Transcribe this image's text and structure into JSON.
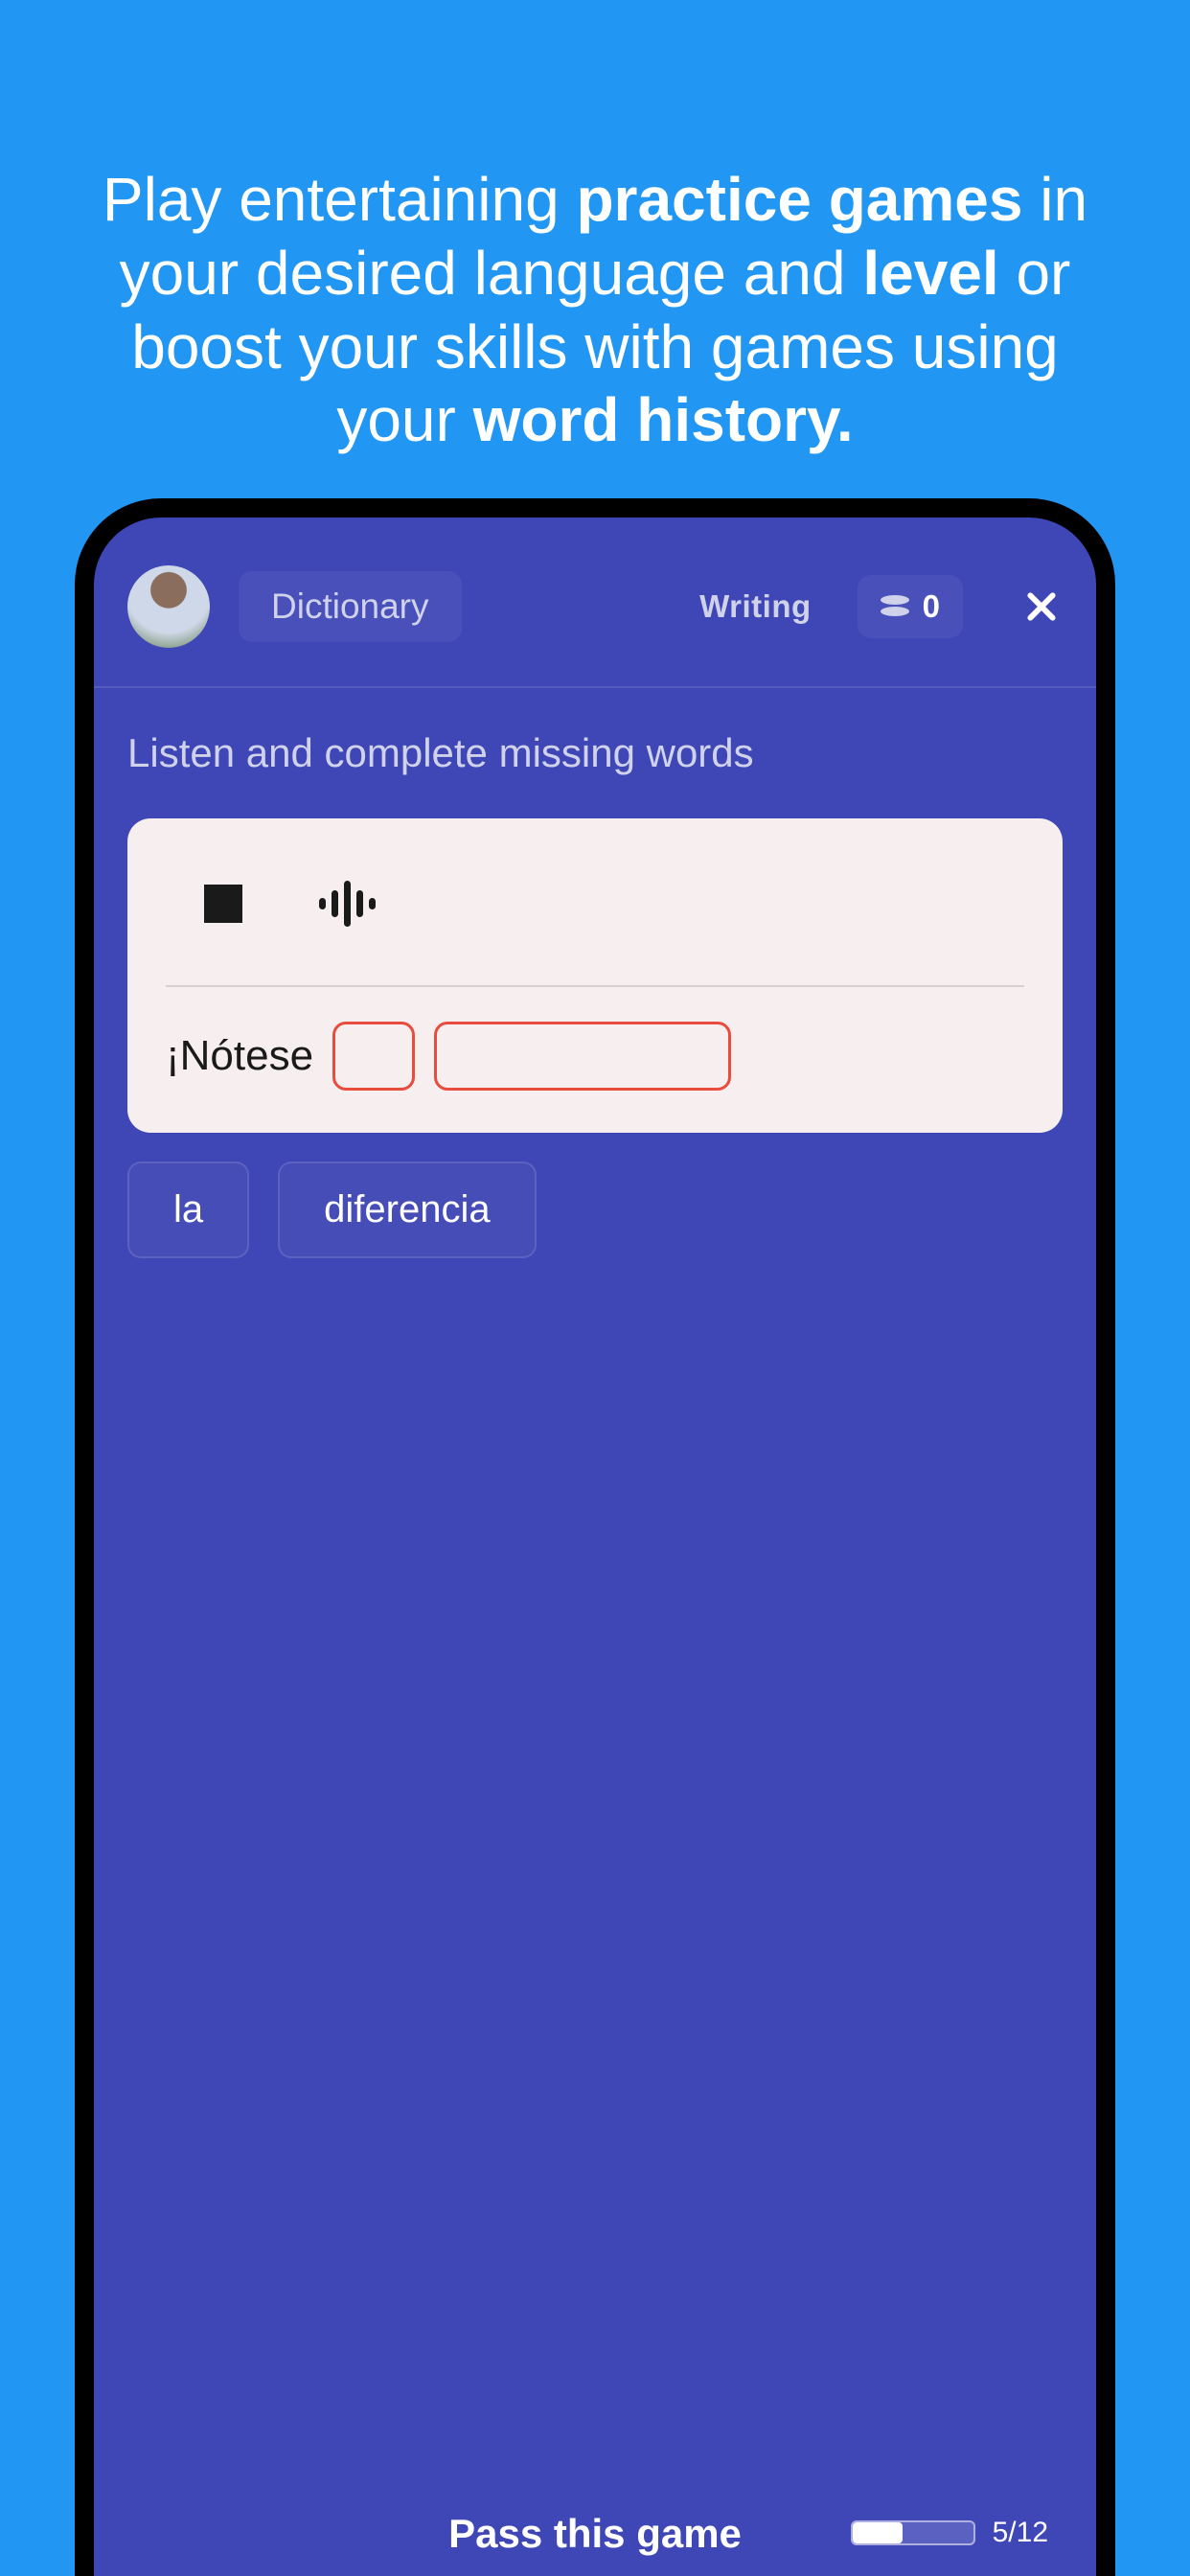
{
  "promo": {
    "p1": "Play entertaining ",
    "b1": "practice games",
    "p2": " in your desired language and ",
    "b2": "level",
    "p3": " or boost your skills with games using your ",
    "b3": "word history.",
    "p4": ""
  },
  "header": {
    "dictionary_label": "Dictionary",
    "mode_label": "Writing",
    "coin_count": "0"
  },
  "instruction": "Listen and complete missing words",
  "sentence": {
    "prefix_word": "¡Nótese"
  },
  "chips": [
    "la",
    "diferencia"
  ],
  "footer": {
    "pass_label": "Pass this game",
    "progress_current": 5,
    "progress_total": 12,
    "progress_text": "5/12",
    "progress_percent": "41.6%"
  }
}
